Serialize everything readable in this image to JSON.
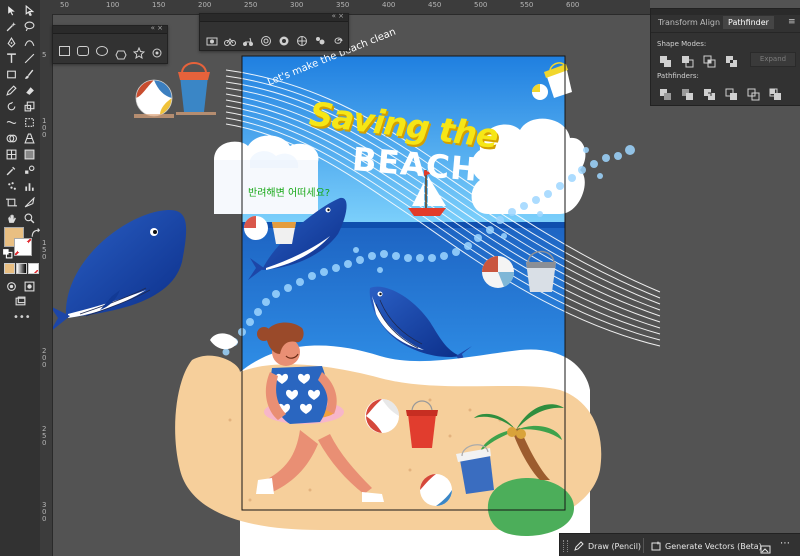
{
  "floating_panels": {
    "shapes_panel": {
      "controls": "«  ×",
      "shapes": [
        "rectangle-shape",
        "rounded-rectangle-shape",
        "ellipse-shape",
        "polygon-shape",
        "star-shape",
        "flare-shape"
      ]
    },
    "symbols_panel": {
      "controls": "«  ×"
    }
  },
  "right_panel": {
    "tabs": [
      "Transform",
      "Align",
      "Pathfinder"
    ],
    "active_tab": "Pathfinder",
    "shape_modes_label": "Shape Modes:",
    "expand_label": "Expand",
    "pathfinders_label": "Pathfinders:"
  },
  "rulers": {
    "top": [
      "50",
      "100",
      "150",
      "200",
      "250",
      "300",
      "350",
      "400",
      "450",
      "500",
      "550",
      "600"
    ],
    "left": [
      "5",
      "1\n0\n0",
      "1\n5\n0",
      "2\n0\n0",
      "2\n5\n0",
      "3\n0\n0"
    ]
  },
  "artwork": {
    "subtitle": "Let's make the beach clean",
    "title_line1": "Saving the",
    "title_line2": "BEACH",
    "korean_text": "반려해변 어떠세요?"
  },
  "bottom_bar": {
    "draw_label": "Draw (Pencil)",
    "generate_label": "Generate Vectors (Beta)"
  },
  "colors": {
    "fill_swatch": "#e9bf82",
    "sea_deep": "#1b66c4",
    "sky": "#3ea8f0",
    "sand": "#f6cf9b",
    "title_yellow": "#f6e616",
    "korean_green": "#16a816"
  }
}
